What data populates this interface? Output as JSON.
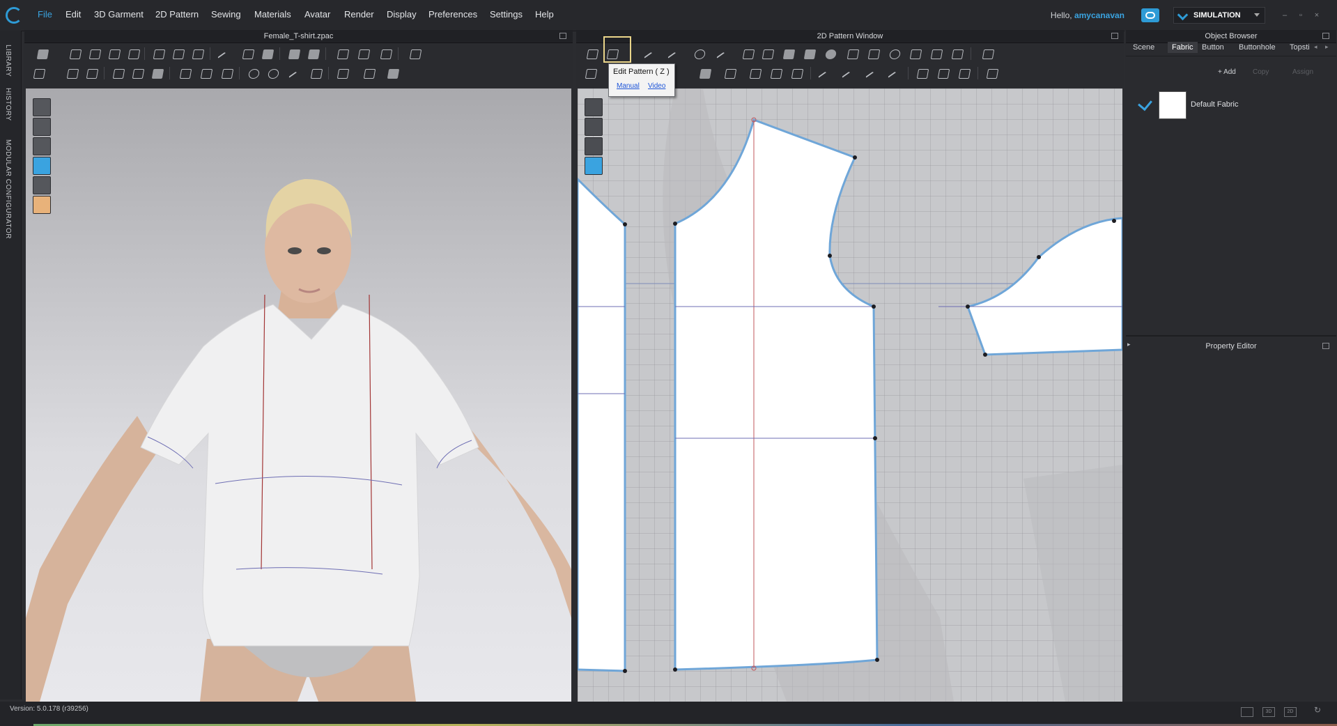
{
  "menu": {
    "items": [
      "File",
      "Edit",
      "3D Garment",
      "2D Pattern",
      "Sewing",
      "Materials",
      "Avatar",
      "Render",
      "Display",
      "Preferences",
      "Settings",
      "Help"
    ],
    "active": "File"
  },
  "user": {
    "greeting": "Hello,",
    "name": "amycanavan"
  },
  "simulation": {
    "label": "SIMULATION"
  },
  "left_tabs": [
    "LIBRARY",
    "HISTORY",
    "MODULAR CONFIGURATOR"
  ],
  "panel_3d": {
    "title": "Female_T-shirt.zpac"
  },
  "panel_2d": {
    "title": "2D Pattern Window"
  },
  "tooltip": {
    "title": "Edit Pattern ( Z )",
    "manual": "Manual",
    "video": "Video"
  },
  "object_browser": {
    "title": "Object Browser",
    "tabs": [
      "Scene",
      "Fabric",
      "Button",
      "Buttonhole",
      "Topsti"
    ],
    "active_tab": "Fabric",
    "actions": [
      "+ Add",
      "Copy",
      "Assign"
    ],
    "fabrics": [
      {
        "name": "Default Fabric",
        "checked": true,
        "swatch_color": "#ffffff"
      }
    ]
  },
  "property_editor": {
    "title": "Property Editor"
  },
  "status": {
    "version": "Version: 5.0.178 (r39256)"
  },
  "view_modes": [
    "3D",
    "2D"
  ],
  "colors": {
    "accent": "#3aa3e0",
    "tooltip_highlight": "#ead58a",
    "pattern_outline": "#6fa6d8"
  }
}
